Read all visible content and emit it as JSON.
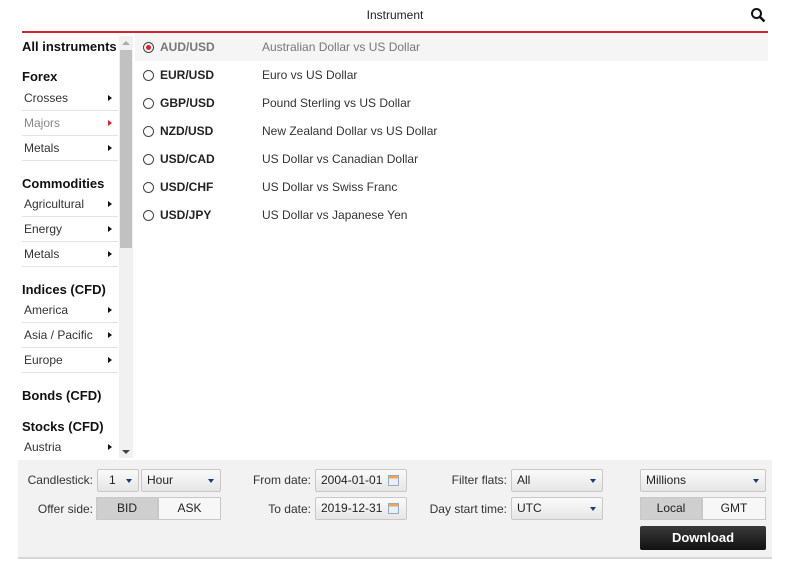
{
  "header": {
    "title": "Instrument",
    "search_icon": "search-icon"
  },
  "colors": {
    "accent": "#d8232a",
    "download_bg": "#1a1a1a"
  },
  "sidebar": {
    "all": "All instruments",
    "groups": [
      {
        "title": "Forex",
        "items": [
          {
            "label": "Crosses"
          },
          {
            "label": "Majors",
            "active": true
          },
          {
            "label": "Metals"
          }
        ]
      },
      {
        "title": "Commodities",
        "items": [
          {
            "label": "Agricultural"
          },
          {
            "label": "Energy"
          },
          {
            "label": "Metals"
          }
        ]
      },
      {
        "title": "Indices (CFD)",
        "items": [
          {
            "label": "America"
          },
          {
            "label": "Asia / Pacific"
          },
          {
            "label": "Europe"
          }
        ]
      },
      {
        "title": "Bonds (CFD)",
        "items": []
      },
      {
        "title": "Stocks (CFD)",
        "items": [
          {
            "label": "Austria"
          }
        ]
      }
    ]
  },
  "instruments": [
    {
      "symbol": "AUD/USD",
      "description": "Australian Dollar vs US Dollar",
      "selected": true
    },
    {
      "symbol": "EUR/USD",
      "description": "Euro vs US Dollar"
    },
    {
      "symbol": "GBP/USD",
      "description": "Pound Sterling vs US Dollar"
    },
    {
      "symbol": "NZD/USD",
      "description": "New Zealand Dollar vs US Dollar"
    },
    {
      "symbol": "USD/CAD",
      "description": "US Dollar vs Canadian Dollar"
    },
    {
      "symbol": "USD/CHF",
      "description": "US Dollar vs Swiss Franc"
    },
    {
      "symbol": "USD/JPY",
      "description": "US Dollar vs Japanese Yen"
    }
  ],
  "controls": {
    "candlestick_label": "Candlestick:",
    "candlestick_count": "1",
    "candlestick_unit": "Hour",
    "offer_label": "Offer side:",
    "bid": "BID",
    "ask": "ASK",
    "offer_selected": "BID",
    "from_label": "From date:",
    "from_value": "2004-01-01",
    "to_label": "To date:",
    "to_value": "2019-12-31",
    "filter_label": "Filter flats:",
    "filter_value": "All",
    "daystart_label": "Day start time:",
    "daystart_value": "UTC",
    "volume_unit": "Millions",
    "local": "Local",
    "gmt": "GMT",
    "time_selected": "Local",
    "download": "Download"
  }
}
